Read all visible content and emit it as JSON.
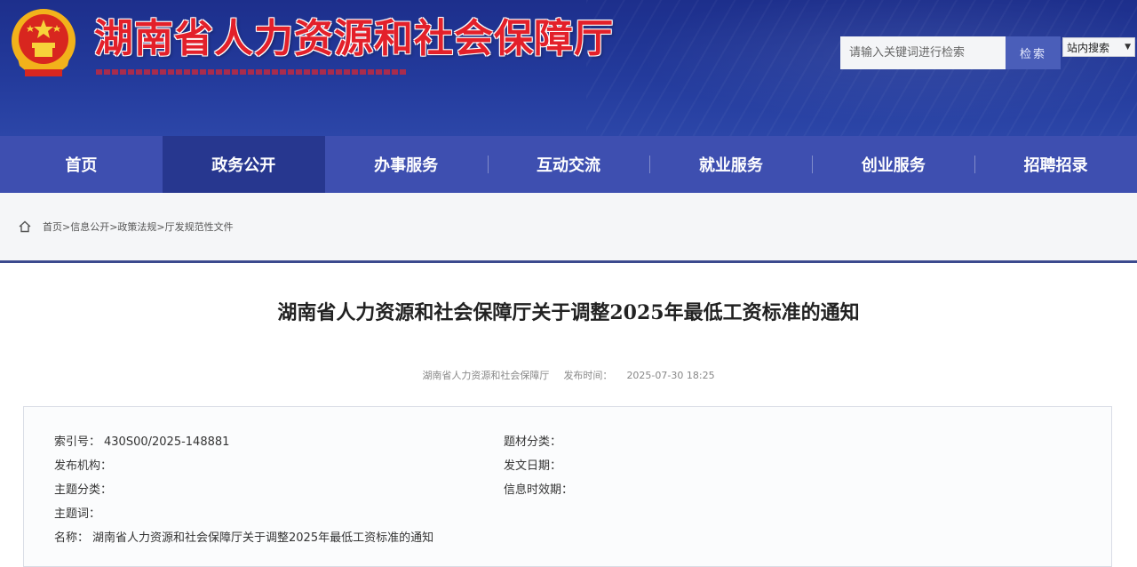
{
  "header": {
    "site_title": "湖南省人力资源和社会保障厅",
    "search_placeholder": "请输入关键词进行检索",
    "search_button": "检索",
    "search_scope": "站内搜索"
  },
  "nav": {
    "items": [
      {
        "label": "首页",
        "active": false
      },
      {
        "label": "政务公开",
        "active": true
      },
      {
        "label": "办事服务",
        "active": false
      },
      {
        "label": "互动交流",
        "active": false
      },
      {
        "label": "就业服务",
        "active": false
      },
      {
        "label": "创业服务",
        "active": false
      },
      {
        "label": "招聘招录",
        "active": false
      }
    ]
  },
  "breadcrumb": {
    "text": "首页>信息公开>政策法规>厅发规范性文件"
  },
  "article": {
    "title": "湖南省人力资源和社会保障厅关于调整2025年最低工资标准的通知",
    "meta_source": "湖南省人力资源和社会保障厅",
    "meta_date_label": "发布时间：",
    "meta_date": "2025-07-30 18:25"
  },
  "info": {
    "index_label": "索引号：",
    "index_value": "430S00/2025-148881",
    "issuer_label": "发布机构：",
    "issuer_value": "",
    "topic_label": "主题分类：",
    "topic_value": "",
    "subject_label": "主题词：",
    "subject_value": "",
    "name_label": "名称：",
    "name_value": "湖南省人力资源和社会保障厅关于调整2025年最低工资标准的通知",
    "genre_label": "题材分类：",
    "genre_value": "",
    "doc_date_label": "发文日期：",
    "doc_date_value": "",
    "validity_label": "信息时效期：",
    "validity_value": ""
  },
  "colors": {
    "header_blue": "#233a9b",
    "nav_blue": "#3e4fb0",
    "nav_active": "#27378f",
    "title_red": "#e3202a"
  }
}
